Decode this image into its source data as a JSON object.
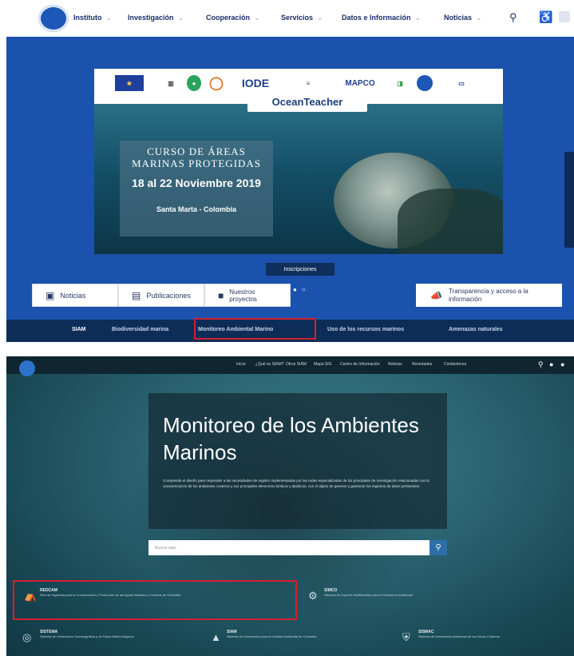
{
  "top_site": {
    "nav": {
      "items": [
        {
          "label": "Instituto",
          "chevron": "⌄"
        },
        {
          "label": "Investigación",
          "chevron": "⌄"
        },
        {
          "label": "Cooperación",
          "chevron": "⌄"
        },
        {
          "label": "Servicios",
          "chevron": "⌄"
        },
        {
          "label": "Datos e Información",
          "chevron": "⌄"
        },
        {
          "label": "Noticias",
          "chevron": "⌄"
        }
      ],
      "search_icon": "search-icon",
      "accessibility_icon": "accessibility-icon"
    },
    "banner": {
      "logos": [
        "IODE",
        "MAPCO"
      ],
      "ocean_teacher": "OceanTeacher",
      "course_title": "CURSO DE ÁREAS MARINAS PROTEGIDAS",
      "course_dates": "18 al 22 Noviembre 2019",
      "course_place": "Santa Marta - Colombia"
    },
    "inscriptions_label": "Inscripciones",
    "carousel_dots": "● ○",
    "quick_links": [
      {
        "label": "Noticias",
        "icon": "news-icon"
      },
      {
        "label": "Publicaciones",
        "icon": "publications-icon"
      },
      {
        "label": "Nuestros proyectos",
        "icon": "projects-icon"
      }
    ],
    "transparency": {
      "label": "Transparencia y acceso a la información",
      "icon": "megaphone-icon"
    },
    "subnav": [
      "SIAM",
      "Biodiversidad marina",
      "Monitoreo Ambiental Marino",
      "Uso de los recursos marinos",
      "Amenazas naturales"
    ]
  },
  "bottom_site": {
    "nav": [
      "Inicio",
      "¿Qué es SIAM?",
      "Otros SIAM",
      "Mapa SIG",
      "Centro de Información",
      "Noticias",
      "Novedades",
      "Contáctenos"
    ],
    "hero_title": "Monitoreo de los Ambientes Marinos",
    "hero_description": "Comprende el diseño para responder a las necesidades de registro implementadas por las redes especializadas de los principales de investigación relacionadas con la caracterización de los ambientes costeros y sus principales elementos bióticos y abióticos, con el objeto de generar y gestionar los registros de datos pertinentes.",
    "search_placeholder": "Buscar aquí",
    "services": [
      {
        "title": "REDCAM",
        "text": "Red de Vigilancia para la Conservación y Protección de las Aguas Marinas y Costeras de Colombia",
        "icon": "redcam-icon"
      },
      {
        "title": "SIMCO",
        "text": "Sistema de Soporte Multitemático para el Monitoreo Ambiental",
        "icon": "simco-icon"
      },
      {
        "title": "SISTEMA",
        "text": "Sistema de Información Oceanográfica y de Datos Meteorológicos",
        "icon": "globe-icon"
      },
      {
        "title": "SIAM",
        "text": "Sistema de Información para la Gestión Ambiental de Colombia",
        "icon": "tree-icon"
      },
      {
        "title": "SISMAC",
        "text": "Sistema de Información Ambiental de las Zonas Costeras",
        "icon": "shield-icon"
      }
    ]
  }
}
